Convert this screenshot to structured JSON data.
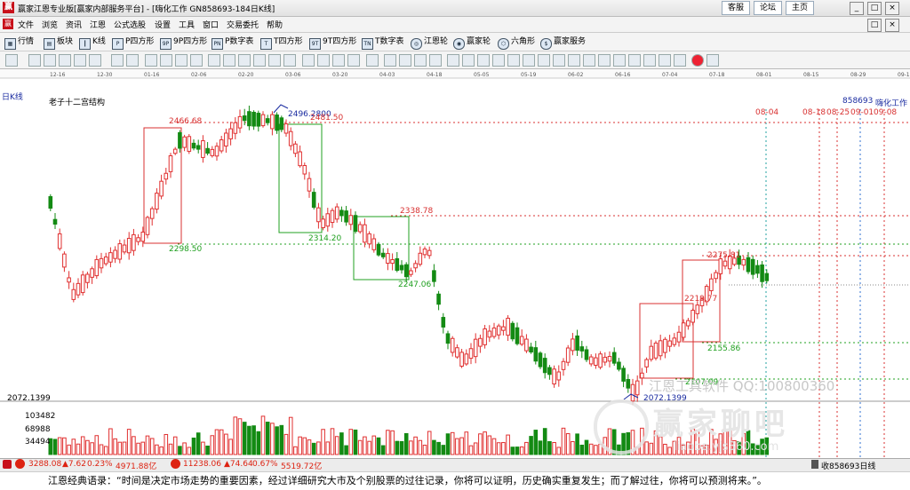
{
  "window": {
    "logo": "赢",
    "title": "赢家江恩专业版[赢家内部服务平台] - [嗨化工作  GN858693-184日K线]",
    "links": [
      "客服",
      "论坛",
      "主页"
    ],
    "controls": [
      "_",
      "□",
      "×"
    ]
  },
  "menu": [
    "文件",
    "浏览",
    "资讯",
    "江恩",
    "公式选股",
    "设置",
    "工具",
    "窗口",
    "交易委托",
    "帮助"
  ],
  "toolbar": [
    "行情",
    "板块",
    "K线",
    "P四方形",
    "9P四方形",
    "P数字表",
    "T四方形",
    "9T四方形",
    "T数字表",
    "江恩轮",
    "赢家轮",
    "六角形",
    "赢家服务"
  ],
  "chart": {
    "period_label": "日K线",
    "structure_title": "老子十二宫结构",
    "code_label": "858693",
    "name_label": "嗨化工作",
    "date_ticks": [
      "12-16",
      "12-30",
      "01-16",
      "02-06",
      "02-20",
      "03-06",
      "03-20",
      "04-03",
      "04-18",
      "05-05",
      "05-19",
      "06-02",
      "06-16",
      "07-04",
      "07-18",
      "08-01",
      "08-15",
      "08-29",
      "09-12"
    ],
    "future_dates": [
      "08-04",
      "08-18",
      "08-25",
      "09-01",
      "09-08"
    ],
    "price_labels": [
      "2466.68",
      "2496.2800",
      "2481.50",
      "2338.78",
      "2314.20",
      "2298.50",
      "2247.06",
      "2275.81",
      "2219.77",
      "2155.86",
      "2107.09",
      "2072.1399"
    ],
    "watermark": "江恩工具软件  QQ:100800360",
    "volume_top": "2072.1399",
    "volume_ticks": [
      "103482",
      "68988",
      "34494"
    ],
    "site_watermark": "赢家聊吧",
    "site_url": "liaoba.yjs360.com"
  },
  "colors": {
    "up": "#e03030",
    "down": "#138a13",
    "guide_red": "#d83030",
    "guide_green": "#20a020",
    "accent_blue": "#1a2ba0"
  },
  "status": {
    "index1_value": "3288.08",
    "index1_change": "▲7.62",
    "index1_pct": "0.23%",
    "index1_amount": "4971.88亿",
    "index2_value": "11238.06",
    "index2_change": "▲74.64",
    "index2_pct": "0.67%",
    "index2_amount": "5519.72亿",
    "right_text": "收858693日线"
  },
  "quote": "江恩经典语录：“时间是决定市场走势的重要因素，经过详细研究大市及个别股票的过往记录，你将可以证明，历史确实重复发生；而了解过往，你将可以预测将来。”。"
}
